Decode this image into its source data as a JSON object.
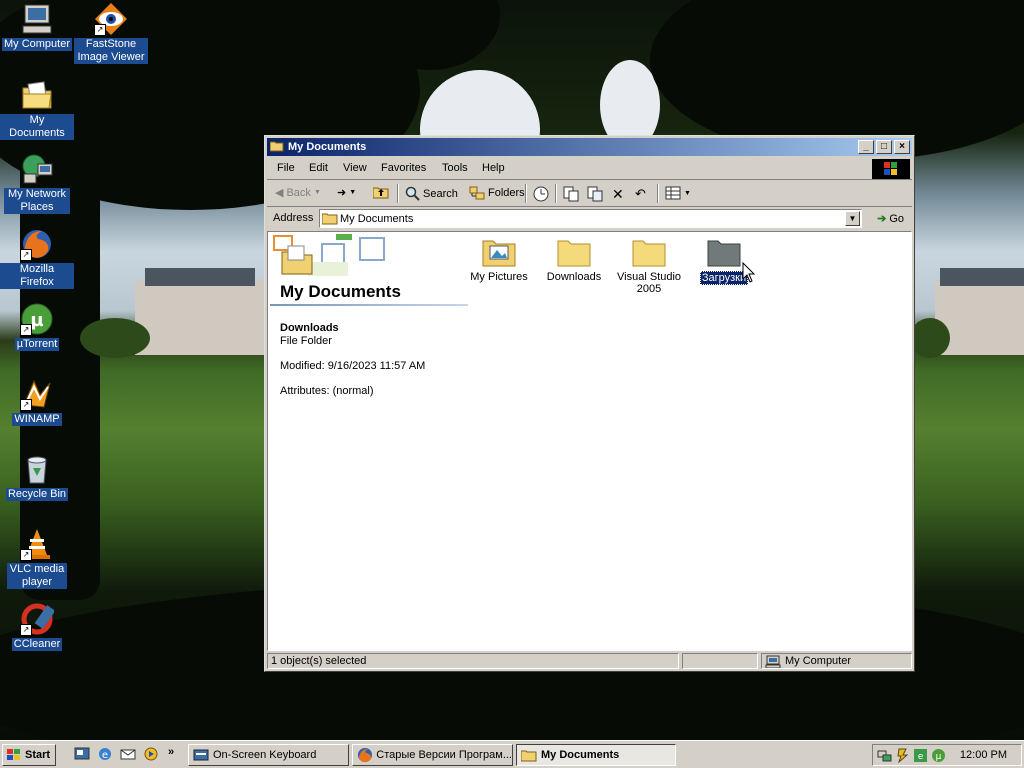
{
  "desktop": {
    "icons": [
      {
        "label": "My Computer",
        "icon": "computer-icon"
      },
      {
        "label": "FastStone Image Viewer",
        "icon": "eye-icon"
      },
      {
        "label": "My Documents",
        "icon": "folder-documents-icon"
      },
      {
        "label": "My Network Places",
        "icon": "network-icon"
      },
      {
        "label": "Mozilla Firefox",
        "icon": "firefox-icon"
      },
      {
        "label": "µTorrent",
        "icon": "utorrent-icon"
      },
      {
        "label": "WINAMP",
        "icon": "winamp-icon"
      },
      {
        "label": "Recycle Bin",
        "icon": "recycle-bin-icon"
      },
      {
        "label": "VLC media player",
        "icon": "vlc-cone-icon"
      },
      {
        "label": "CCleaner",
        "icon": "ccleaner-icon"
      }
    ]
  },
  "window": {
    "title": "My Documents",
    "menu": [
      "File",
      "Edit",
      "View",
      "Favorites",
      "Tools",
      "Help"
    ],
    "toolbar": {
      "back": "Back",
      "search": "Search",
      "folders": "Folders"
    },
    "address": {
      "label": "Address",
      "value": "My Documents",
      "go": "Go"
    },
    "left_pane": {
      "title": "My Documents",
      "selected_name": "Downloads",
      "selected_type": "File Folder",
      "modified": "Modified: 9/16/2023 11:57 AM",
      "attributes": "Attributes: (normal)"
    },
    "files": [
      {
        "label": "My Pictures",
        "icon": "my-pictures-folder-icon"
      },
      {
        "label": "Downloads",
        "icon": "folder-icon"
      },
      {
        "label": "Visual Studio 2005",
        "icon": "folder-icon"
      },
      {
        "label": "Загрузки",
        "icon": "folder-icon",
        "selected": true
      }
    ],
    "status": {
      "left": "1 object(s) selected",
      "zone": "My Computer"
    }
  },
  "taskbar": {
    "start": "Start",
    "quick_launch_more": "»",
    "tasks": [
      {
        "label": "On-Screen Keyboard",
        "active": false
      },
      {
        "label": "Старые Версии Програм...",
        "active": false
      },
      {
        "label": "My Documents",
        "active": true
      }
    ],
    "clock": "12:00 PM"
  },
  "colors": {
    "titlebar_start": "#0a246a",
    "titlebar_end": "#a6caf0",
    "selection": "#0a246a",
    "face": "#d4d0c8"
  }
}
